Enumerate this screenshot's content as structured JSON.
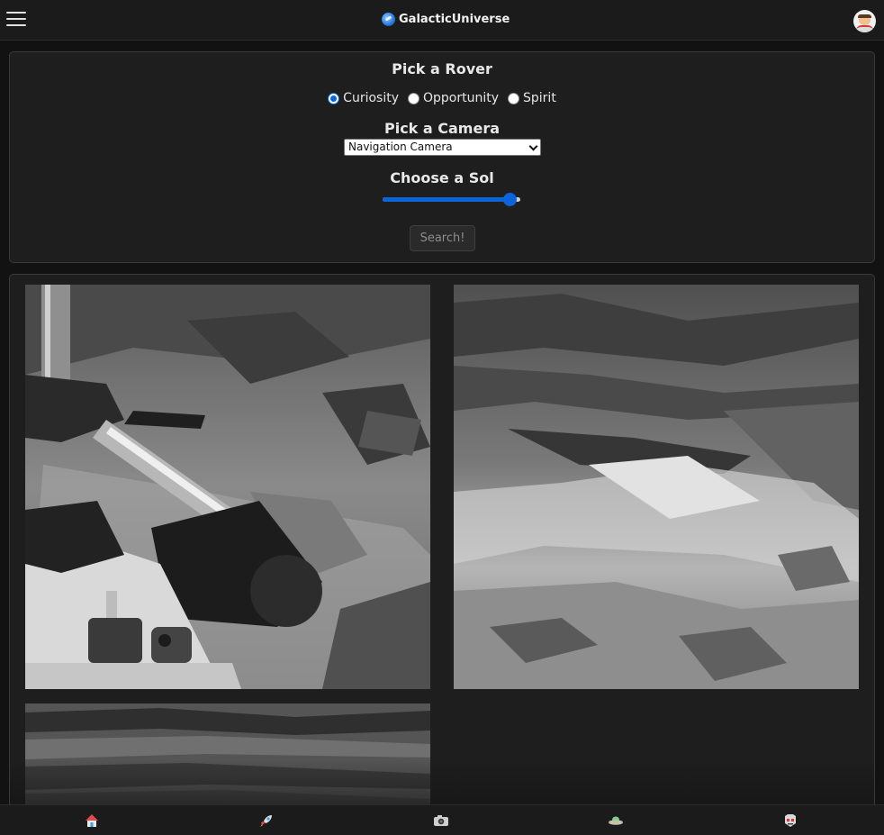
{
  "header": {
    "brand": "GalacticUniverse",
    "menu_icon": "hamburger-menu-icon",
    "logo_icon": "galaxy-logo-icon",
    "avatar_icon": "astronaut-avatar-icon"
  },
  "search": {
    "rover_heading": "Pick a Rover",
    "rovers": [
      {
        "label": "Curiosity",
        "selected": true
      },
      {
        "label": "Opportunity",
        "selected": false
      },
      {
        "label": "Spirit",
        "selected": false
      }
    ],
    "camera_heading": "Pick a Camera",
    "camera_selected": "Navigation Camera",
    "sol_heading": "Choose a Sol",
    "sol_level": 0.93,
    "search_button": "Search!"
  },
  "gallery": {
    "photos": [
      {
        "alt": "rover-arm-terrain-photo"
      },
      {
        "alt": "layered-rock-terrain-photo"
      },
      {
        "alt": "layered-ridge-photo"
      }
    ]
  },
  "bottom_nav": [
    {
      "icon": "home-icon"
    },
    {
      "icon": "rocket-icon"
    },
    {
      "icon": "camera-icon"
    },
    {
      "icon": "ufo-icon"
    },
    {
      "icon": "alien-icon"
    }
  ],
  "colors": {
    "accent": "#0b65d8",
    "background": "#121212",
    "panel": "#1e1e1e"
  }
}
